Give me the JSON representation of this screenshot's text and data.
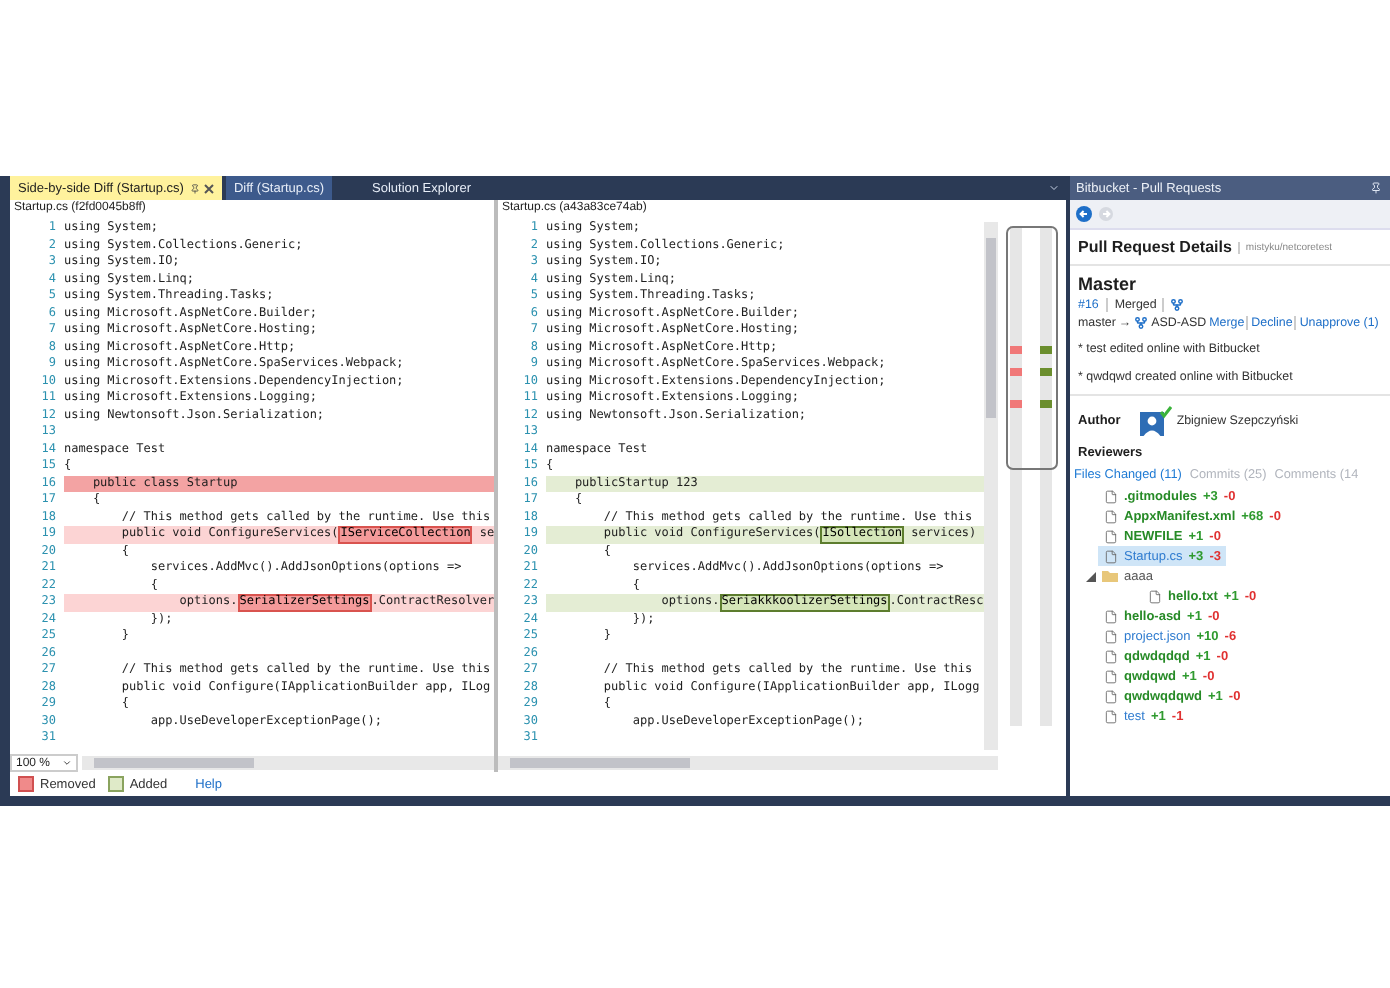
{
  "tabs": [
    {
      "label": "Side-by-side Diff (Startup.cs)",
      "selected": true,
      "kind": "document"
    },
    {
      "label": "Diff (Startup.cs)",
      "selected": false,
      "kind": "document"
    },
    {
      "label": "Solution Explorer",
      "selected": false,
      "kind": "tool"
    }
  ],
  "panes": [
    {
      "kind": "removed",
      "header": "Startup.cs (f2fd0045b8ff)",
      "zoom": "100 %",
      "lines": [
        {
          "n": "1",
          "text": "using System;",
          "kind": "same"
        },
        {
          "n": "2",
          "text": "using System.Collections.Generic;",
          "kind": "same"
        },
        {
          "n": "3",
          "text": "using System.IO;",
          "kind": "same"
        },
        {
          "n": "4",
          "text": "using System.Linq;",
          "kind": "same"
        },
        {
          "n": "5",
          "text": "using System.Threading.Tasks;",
          "kind": "same"
        },
        {
          "n": "6",
          "text": "using Microsoft.AspNetCore.Builder;",
          "kind": "same"
        },
        {
          "n": "7",
          "text": "using Microsoft.AspNetCore.Hosting;",
          "kind": "same"
        },
        {
          "n": "8",
          "text": "using Microsoft.AspNetCore.Http;",
          "kind": "same"
        },
        {
          "n": "9",
          "text": "using Microsoft.AspNetCore.SpaServices.Webpack;",
          "kind": "same"
        },
        {
          "n": "10",
          "text": "using Microsoft.Extensions.DependencyInjection;",
          "kind": "same"
        },
        {
          "n": "11",
          "text": "using Microsoft.Extensions.Logging;",
          "kind": "same"
        },
        {
          "n": "12",
          "text": "using Newtonsoft.Json.Serialization;",
          "kind": "same"
        },
        {
          "n": "13",
          "kind": "same"
        },
        {
          "n": "14",
          "text": "namespace Test",
          "kind": "same"
        },
        {
          "n": "15",
          "text": "{",
          "kind": "same"
        },
        {
          "n": "16",
          "text": "    public class Startup",
          "kind": "whole"
        },
        {
          "n": "17",
          "text": "    {",
          "kind": "same"
        },
        {
          "n": "18",
          "text": "        // This method gets called by the runtime. Use this",
          "kind": "same"
        },
        {
          "n": "19",
          "parts": [
            {
              "text": "        public void ConfigureServices(",
              "changed": false
            },
            {
              "text": "IServiceCollection",
              "changed": true
            },
            {
              "text": " se",
              "changed": false
            }
          ],
          "kind": "changed"
        },
        {
          "n": "20",
          "text": "        {",
          "kind": "same"
        },
        {
          "n": "21",
          "text": "            services.AddMvc().AddJsonOptions(options =>",
          "kind": "same"
        },
        {
          "n": "22",
          "text": "            {",
          "kind": "same"
        },
        {
          "n": "23",
          "parts": [
            {
              "text": "                options.",
              "changed": false
            },
            {
              "text": "SerializerSettings",
              "changed": true
            },
            {
              "text": ".ContractResolver",
              "changed": false
            }
          ],
          "kind": "changed"
        },
        {
          "n": "24",
          "text": "            });",
          "kind": "same"
        },
        {
          "n": "25",
          "text": "        }",
          "kind": "same"
        },
        {
          "n": "26",
          "kind": "same"
        },
        {
          "n": "27",
          "text": "        // This method gets called by the runtime. Use this",
          "kind": "same"
        },
        {
          "n": "28",
          "text": "        public void Configure(IApplicationBuilder app, ILog",
          "kind": "same"
        },
        {
          "n": "29",
          "text": "        {",
          "kind": "same"
        },
        {
          "n": "30",
          "text": "            app.UseDeveloperExceptionPage();",
          "kind": "same"
        },
        {
          "n": "31",
          "kind": "same"
        }
      ]
    },
    {
      "kind": "added",
      "header": "Startup.cs (a43a83ce74ab)",
      "lines": [
        {
          "n": "1",
          "text": "using System;",
          "kind": "same"
        },
        {
          "n": "2",
          "text": "using System.Collections.Generic;",
          "kind": "same"
        },
        {
          "n": "3",
          "text": "using System.IO;",
          "kind": "same"
        },
        {
          "n": "4",
          "text": "using System.Linq;",
          "kind": "same"
        },
        {
          "n": "5",
          "text": "using System.Threading.Tasks;",
          "kind": "same"
        },
        {
          "n": "6",
          "text": "using Microsoft.AspNetCore.Builder;",
          "kind": "same"
        },
        {
          "n": "7",
          "text": "using Microsoft.AspNetCore.Hosting;",
          "kind": "same"
        },
        {
          "n": "8",
          "text": "using Microsoft.AspNetCore.Http;",
          "kind": "same"
        },
        {
          "n": "9",
          "text": "using Microsoft.AspNetCore.SpaServices.Webpack;",
          "kind": "same"
        },
        {
          "n": "10",
          "text": "using Microsoft.Extensions.DependencyInjection;",
          "kind": "same"
        },
        {
          "n": "11",
          "text": "using Microsoft.Extensions.Logging;",
          "kind": "same"
        },
        {
          "n": "12",
          "text": "using Newtonsoft.Json.Serialization;",
          "kind": "same"
        },
        {
          "n": "13",
          "kind": "same"
        },
        {
          "n": "14",
          "text": "namespace Test",
          "kind": "same"
        },
        {
          "n": "15",
          "text": "{",
          "kind": "same"
        },
        {
          "n": "16",
          "text": "    publicStartup 123",
          "kind": "changed"
        },
        {
          "n": "17",
          "text": "    {",
          "kind": "same"
        },
        {
          "n": "18",
          "text": "        // This method gets called by the runtime. Use this",
          "kind": "same"
        },
        {
          "n": "19",
          "parts": [
            {
              "text": "        public void ConfigureServices(",
              "changed": false
            },
            {
              "text": "ISollection",
              "changed": true
            },
            {
              "text": " services)",
              "changed": false
            }
          ],
          "kind": "changed"
        },
        {
          "n": "20",
          "text": "        {",
          "kind": "same"
        },
        {
          "n": "21",
          "text": "            services.AddMvc().AddJsonOptions(options =>",
          "kind": "same"
        },
        {
          "n": "22",
          "text": "            {",
          "kind": "same"
        },
        {
          "n": "23",
          "parts": [
            {
              "text": "                options.",
              "changed": false
            },
            {
              "text": "SeriakkkoolizerSettings",
              "changed": true
            },
            {
              "text": ".ContractResc",
              "changed": false
            }
          ],
          "kind": "changed"
        },
        {
          "n": "24",
          "text": "            });",
          "kind": "same"
        },
        {
          "n": "25",
          "text": "        }",
          "kind": "same"
        },
        {
          "n": "26",
          "kind": "same"
        },
        {
          "n": "27",
          "text": "        // This method gets called by the runtime. Use this",
          "kind": "same"
        },
        {
          "n": "28",
          "text": "        public void Configure(IApplicationBuilder app, ILogg",
          "kind": "same"
        },
        {
          "n": "29",
          "text": "        {",
          "kind": "same"
        },
        {
          "n": "30",
          "text": "            app.UseDeveloperExceptionPage();",
          "kind": "same"
        },
        {
          "n": "31",
          "kind": "same"
        }
      ]
    }
  ],
  "legend": [
    {
      "label": "Removed",
      "kind": "removed"
    },
    {
      "label": "Added",
      "kind": "added"
    },
    {
      "label": "Help",
      "kind": "link"
    }
  ],
  "bitbucket": {
    "title": "Bitbucket - Pull Requests",
    "heading": "Pull Request Details",
    "repo": "mistyku/netcoretest",
    "pr_title": "Master",
    "pr_number": "#16",
    "status": "Merged",
    "source_branch": "master",
    "arrow": "→",
    "target_branch": "ASD-ASD",
    "actions": [
      "Merge",
      "Decline",
      "Unapprove (1)"
    ],
    "commits": [
      "* test edited online with Bitbucket",
      "* qwdqwd created online with Bitbucket"
    ],
    "author_label": "Author",
    "author": "Zbigniew Szepczyński",
    "reviewers_label": "Reviewers",
    "tabs": [
      {
        "label": "Files Changed (11)",
        "selected": true
      },
      {
        "label": "Commits (25)",
        "selected": false
      },
      {
        "label": "Comments (14",
        "selected": false
      }
    ],
    "files": [
      {
        "name": ".gitmodules",
        "added": "+3",
        "removed": "-0",
        "kind": "added",
        "selected": false
      },
      {
        "name": "AppxManifest.xml",
        "added": "+68",
        "removed": "-0",
        "kind": "added",
        "selected": false
      },
      {
        "name": "NEWFILE",
        "added": "+1",
        "removed": "-0",
        "kind": "added",
        "selected": false
      },
      {
        "name": "Startup.cs",
        "added": "+3",
        "removed": "-3",
        "kind": "modified",
        "selected": true
      },
      {
        "name": "aaaa",
        "kind": "folder",
        "expanded": true,
        "selected": false,
        "children": [
          {
            "name": "hello.txt",
            "added": "+1",
            "removed": "-0",
            "kind": "added",
            "selected": false
          }
        ]
      },
      {
        "name": "hello-asd",
        "added": "+1",
        "removed": "-0",
        "kind": "added",
        "selected": false
      },
      {
        "name": "project.json",
        "added": "+10",
        "removed": "-6",
        "kind": "modified",
        "selected": false
      },
      {
        "name": "qdwdqdqd",
        "added": "+1",
        "removed": "-0",
        "kind": "added",
        "selected": false
      },
      {
        "name": "qwdqwd",
        "added": "+1",
        "removed": "-0",
        "kind": "added",
        "selected": false
      },
      {
        "name": "qwdwqdqwd",
        "added": "+1",
        "removed": "-0",
        "kind": "added",
        "selected": false
      },
      {
        "name": "test",
        "added": "+1",
        "removed": "-1",
        "kind": "modified",
        "selected": false
      }
    ]
  }
}
